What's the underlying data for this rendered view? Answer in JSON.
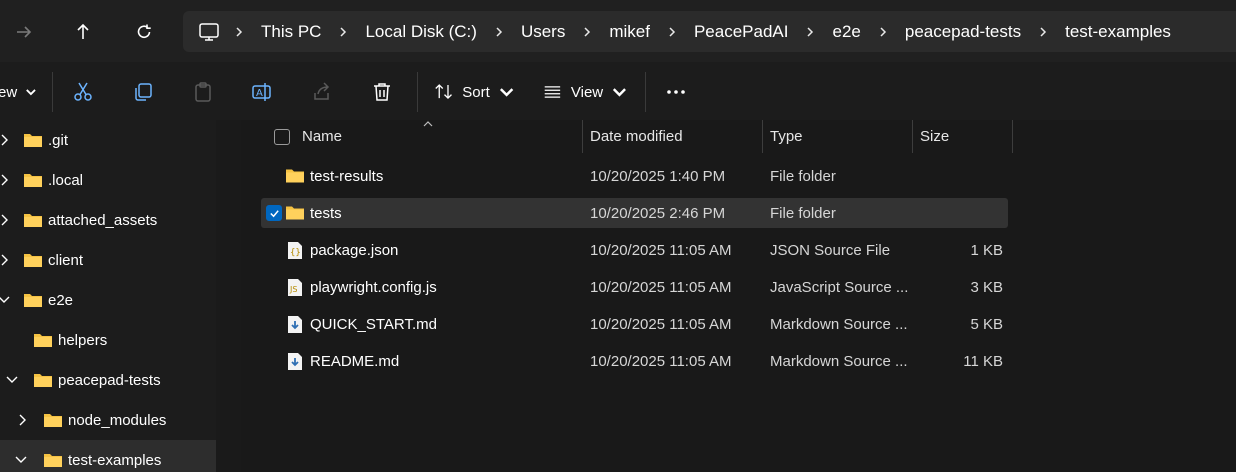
{
  "address_bar": {
    "crumbs": [
      "This PC",
      "Local Disk (C:)",
      "Users",
      "mikef",
      "PeacePadAI",
      "e2e",
      "peacepad-tests",
      "test-examples"
    ]
  },
  "toolbar": {
    "new_partial_label": "ew",
    "sort_label": "Sort",
    "view_label": "View"
  },
  "sidebar": {
    "items": [
      {
        "label": ".git",
        "expanded": false
      },
      {
        "label": ".local",
        "expanded": false
      },
      {
        "label": "attached_assets",
        "expanded": false
      },
      {
        "label": "client",
        "expanded": false
      },
      {
        "label": "e2e",
        "expanded": true
      },
      {
        "label": "helpers",
        "expanded": null
      },
      {
        "label": "peacepad-tests",
        "expanded": true
      },
      {
        "label": "node_modules",
        "expanded": false
      },
      {
        "label": "test-examples",
        "expanded": true,
        "selected": true
      }
    ]
  },
  "filelist": {
    "columns": [
      "Name",
      "Date modified",
      "Type",
      "Size"
    ],
    "rows": [
      {
        "name": "test-results",
        "date": "10/20/2025 1:40 PM",
        "type": "File folder",
        "size": "",
        "icon": "folder-icon"
      },
      {
        "name": "tests",
        "date": "10/20/2025 2:46 PM",
        "type": "File folder",
        "size": "",
        "icon": "folder-icon",
        "selected": true
      },
      {
        "name": "package.json",
        "date": "10/20/2025 11:05 AM",
        "type": "JSON Source File",
        "size": "1 KB",
        "icon": "json-file-icon"
      },
      {
        "name": "playwright.config.js",
        "date": "10/20/2025 11:05 AM",
        "type": "JavaScript Source ...",
        "size": "3 KB",
        "icon": "js-file-icon"
      },
      {
        "name": "QUICK_START.md",
        "date": "10/20/2025 11:05 AM",
        "type": "Markdown Source ...",
        "size": "5 KB",
        "icon": "markdown-file-icon"
      },
      {
        "name": "README.md",
        "date": "10/20/2025 11:05 AM",
        "type": "Markdown Source ...",
        "size": "11 KB",
        "icon": "markdown-file-icon"
      }
    ]
  },
  "colors": {
    "accent": "#0067c0",
    "folder": "#f5c242",
    "background": "#191919"
  }
}
